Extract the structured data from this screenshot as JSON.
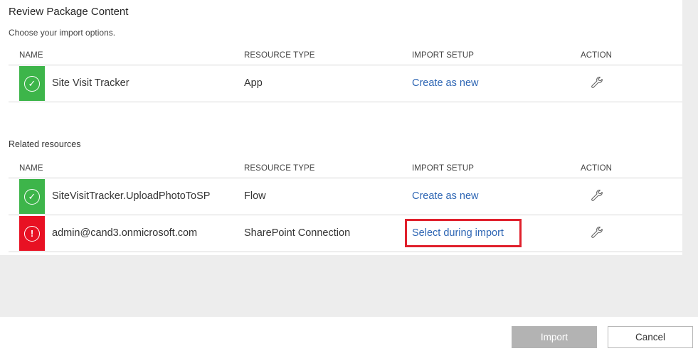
{
  "panel": {
    "title": "Review Package Content",
    "subtitle": "Choose your import options."
  },
  "columns": {
    "name": "NAME",
    "resource_type": "RESOURCE TYPE",
    "import_setup": "IMPORT SETUP",
    "action": "ACTION"
  },
  "package_rows": [
    {
      "status": "ok",
      "name": "Site Visit Tracker",
      "resource_type": "App",
      "import_setup": "Create as new",
      "action_icon": "wrench-icon"
    }
  ],
  "related": {
    "label": "Related resources",
    "rows": [
      {
        "status": "ok",
        "name": "SiteVisitTracker.UploadPhotoToSP",
        "resource_type": "Flow",
        "import_setup": "Create as new",
        "action_icon": "wrench-icon"
      },
      {
        "status": "error",
        "name": "admin@cand3.onmicrosoft.com",
        "resource_type": "SharePoint Connection",
        "import_setup": "Select during import",
        "action_icon": "wrench-icon",
        "highlighted": true
      }
    ]
  },
  "status_icons": {
    "ok": "✓",
    "error": "!"
  },
  "colors": {
    "ok": "#3db54a",
    "error": "#e81123",
    "link": "#2e66b4",
    "highlight": "#e0202c",
    "import_button_disabled": "#b3b3b3"
  },
  "footer": {
    "import_label": "Import",
    "cancel_label": "Cancel"
  }
}
